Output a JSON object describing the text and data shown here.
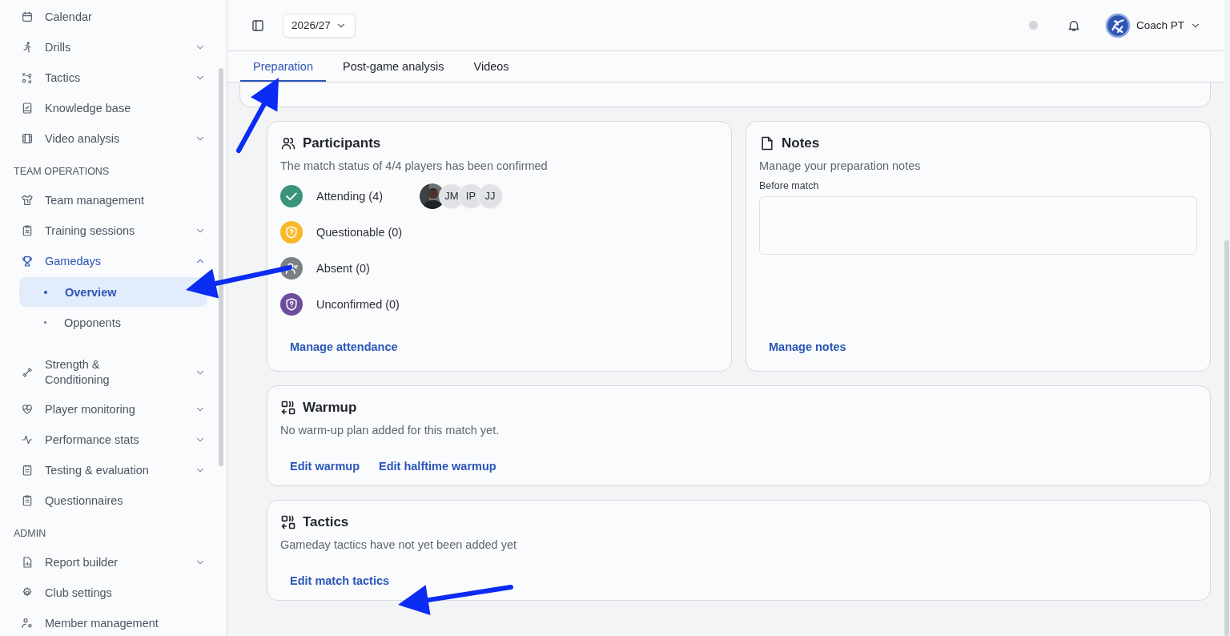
{
  "sidebar": {
    "sections": [
      {
        "items": [
          {
            "label": "Calendar",
            "selected": false
          },
          {
            "label": "Drills",
            "selected": false,
            "expanded": false
          },
          {
            "label": "Tactics",
            "selected": false,
            "expanded": false
          },
          {
            "label": "Knowledge base",
            "selected": false
          },
          {
            "label": "Video analysis",
            "selected": false,
            "expanded": false
          }
        ]
      },
      {
        "heading": "TEAM OPERATIONS",
        "items": [
          {
            "label": "Team management",
            "selected": false
          },
          {
            "label": "Training sessions",
            "selected": false,
            "expanded": false
          },
          {
            "label": "Gamedays",
            "selected": true,
            "expanded": true,
            "children": [
              {
                "label": "Overview",
                "selected": true
              },
              {
                "label": "Opponents",
                "selected": false
              }
            ]
          },
          {
            "label": "Strength & Conditioning",
            "selected": false,
            "expanded": false
          },
          {
            "label": "Player monitoring",
            "selected": false,
            "expanded": false
          },
          {
            "label": "Performance stats",
            "selected": false,
            "expanded": false
          },
          {
            "label": "Testing & evaluation",
            "selected": false,
            "expanded": false
          },
          {
            "label": "Questionnaires",
            "selected": false
          }
        ]
      },
      {
        "heading": "ADMIN",
        "items": [
          {
            "label": "Report builder",
            "selected": false,
            "expanded": false
          },
          {
            "label": "Club settings",
            "selected": false
          },
          {
            "label": "Member management",
            "selected": false
          }
        ]
      }
    ]
  },
  "header": {
    "season": "2026/27",
    "user": "Coach PT"
  },
  "tabs": [
    {
      "label": "Preparation",
      "selected": true
    },
    {
      "label": "Post-game analysis",
      "selected": false
    },
    {
      "label": "Videos",
      "selected": false
    }
  ],
  "participants": {
    "title": "Participants",
    "description": "The match status of 4/4 players has been confirmed",
    "statuses": [
      {
        "kind": "attending",
        "label": "Attending (4)",
        "color": "#3b9479",
        "avatars": [
          {
            "kind": "picture"
          },
          {
            "kind": "initials",
            "initials": "JM"
          },
          {
            "kind": "initials",
            "initials": "IP"
          },
          {
            "kind": "initials",
            "initials": "JJ"
          }
        ]
      },
      {
        "kind": "questionable",
        "label": "Questionable (0)",
        "color": "#f8b82a"
      },
      {
        "kind": "absent",
        "label": "Absent (0)",
        "color": "#7b7f86"
      },
      {
        "kind": "unconfirmed",
        "label": "Unconfirmed (0)",
        "color": "#6d4c9c"
      }
    ],
    "link": "Manage attendance"
  },
  "notes": {
    "title": "Notes",
    "description": "Manage your preparation notes",
    "field_label": "Before match",
    "link": "Manage notes"
  },
  "warmup": {
    "title": "Warmup",
    "description": "No warm-up plan added for this match yet.",
    "links": [
      "Edit warmup",
      "Edit halftime warmup"
    ]
  },
  "tactics": {
    "title": "Tactics",
    "description": "Gameday tactics have not yet been added yet",
    "links": [
      "Edit match tactics"
    ]
  }
}
